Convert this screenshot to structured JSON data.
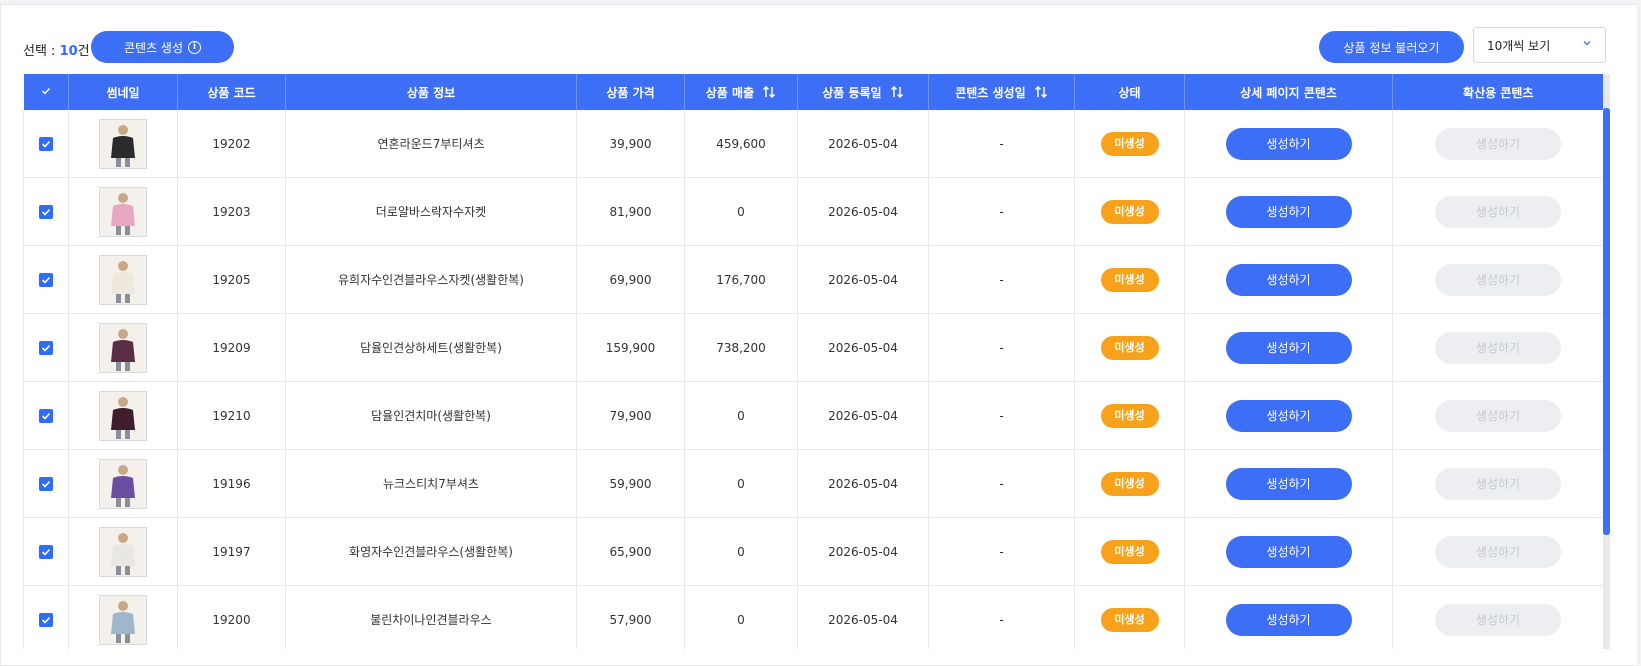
{
  "toolbar": {
    "selection_label": "선택 : ",
    "selection_count": "10",
    "selection_unit": "건",
    "content_create_label": "콘텐츠 생성",
    "load_product_label": "상품 정보 불러오기",
    "page_size_value": "10개씩 보기"
  },
  "table": {
    "headers": [
      "썸네일",
      "상품 코드",
      "상품 정보",
      "상품 가격",
      "상품 매출",
      "상품 등록일",
      "콘텐츠 생성일",
      "상태",
      "상세 페이지 콘텐츠",
      "확산용 콘텐츠"
    ],
    "rows": [
      {
        "code": "19202",
        "name": "연혼라운드7부티셔츠",
        "price": "39,900",
        "sales": "459,600",
        "registered": "2026-05-04",
        "content_date": "-",
        "status": "미생성",
        "detail_btn": "생성하기",
        "spread_btn": "생성하기",
        "thumb_color": "#2b2b2b"
      },
      {
        "code": "19203",
        "name": "더로얄바스락자수자켓",
        "price": "81,900",
        "sales": "0",
        "registered": "2026-05-04",
        "content_date": "-",
        "status": "미생성",
        "detail_btn": "생성하기",
        "spread_btn": "생성하기",
        "thumb_color": "#e7a7c0"
      },
      {
        "code": "19205",
        "name": "유희자수인견블라우스자켓(생활한복)",
        "price": "69,900",
        "sales": "176,700",
        "registered": "2026-05-04",
        "content_date": "-",
        "status": "미생성",
        "detail_btn": "생성하기",
        "spread_btn": "생성하기",
        "thumb_color": "#efe9dd"
      },
      {
        "code": "19209",
        "name": "담율인견상하세트(생활한복)",
        "price": "159,900",
        "sales": "738,200",
        "registered": "2026-05-04",
        "content_date": "-",
        "status": "미생성",
        "detail_btn": "생성하기",
        "spread_btn": "생성하기",
        "thumb_color": "#5a2f45"
      },
      {
        "code": "19210",
        "name": "담율인견치마(생활한복)",
        "price": "79,900",
        "sales": "0",
        "registered": "2026-05-04",
        "content_date": "-",
        "status": "미생성",
        "detail_btn": "생성하기",
        "spread_btn": "생성하기",
        "thumb_color": "#3e1d2c"
      },
      {
        "code": "19196",
        "name": "뉴크스티치7부셔츠",
        "price": "59,900",
        "sales": "0",
        "registered": "2026-05-04",
        "content_date": "-",
        "status": "미생성",
        "detail_btn": "생성하기",
        "spread_btn": "생성하기",
        "thumb_color": "#6a4fa0"
      },
      {
        "code": "19197",
        "name": "화영자수인견블라우스(생활한복)",
        "price": "65,900",
        "sales": "0",
        "registered": "2026-05-04",
        "content_date": "-",
        "status": "미생성",
        "detail_btn": "생성하기",
        "spread_btn": "생성하기",
        "thumb_color": "#e9e7e3"
      },
      {
        "code": "19200",
        "name": "불린차이나인견블라우스",
        "price": "57,900",
        "sales": "0",
        "registered": "2026-05-04",
        "content_date": "-",
        "status": "미생성",
        "detail_btn": "생성하기",
        "spread_btn": "생성하기",
        "thumb_color": "#9fb7c9"
      }
    ]
  },
  "colors": {
    "accent": "#3d6ef6",
    "badge": "#f7a21a",
    "disabled_bg": "#eceef1"
  }
}
